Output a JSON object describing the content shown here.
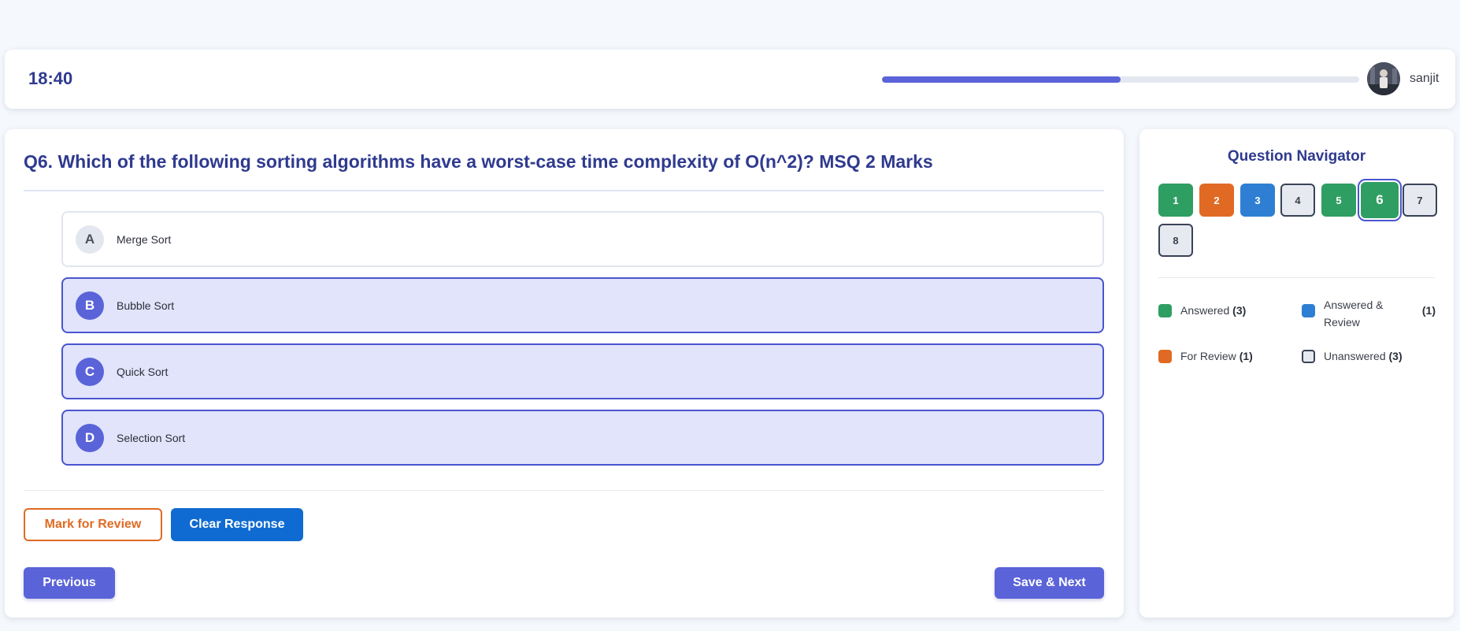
{
  "header": {
    "timer": "18:40",
    "progress_percent": 50,
    "user_name": "sanjit"
  },
  "question": {
    "text": "Q6. Which of the following sorting algorithms have a worst-case time complexity of O(n^2)? MSQ 2 Marks",
    "options": [
      {
        "letter": "A",
        "text": "Merge Sort",
        "selected": false
      },
      {
        "letter": "B",
        "text": "Bubble Sort",
        "selected": true
      },
      {
        "letter": "C",
        "text": "Quick Sort",
        "selected": true
      },
      {
        "letter": "D",
        "text": "Selection Sort",
        "selected": true
      }
    ]
  },
  "actions": {
    "mark_review": "Mark for Review",
    "clear_response": "Clear Response",
    "previous": "Previous",
    "save_next": "Save & Next"
  },
  "navigator": {
    "title": "Question Navigator",
    "current": "6",
    "questions": [
      {
        "number": "1",
        "status": "answered"
      },
      {
        "number": "2",
        "status": "review"
      },
      {
        "number": "3",
        "status": "ans-review"
      },
      {
        "number": "4",
        "status": "unanswered"
      },
      {
        "number": "5",
        "status": "answered"
      },
      {
        "number": "6",
        "status": "answered"
      },
      {
        "number": "7",
        "status": "unanswered"
      },
      {
        "number": "8",
        "status": "unanswered"
      }
    ],
    "legend": {
      "answered": {
        "label": "Answered",
        "count": "(3)"
      },
      "answered_review": {
        "label_line1": "Answered &",
        "label_line2": "Review",
        "count": "(1)"
      },
      "for_review": {
        "label": "For Review",
        "count": "(1)"
      },
      "unanswered": {
        "label": "Unanswered",
        "count": "(3)"
      }
    }
  },
  "colors": {
    "accent": "#5a63d8",
    "answered": "#2f9e62",
    "review": "#e06a23",
    "answered_review": "#2e7fd3",
    "unanswered": "#e6e9f0"
  }
}
